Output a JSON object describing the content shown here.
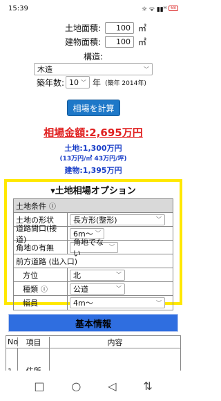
{
  "status": {
    "time": "15:39",
    "icons": "☼ ᯤ ▮▮ᴴ",
    "battery": "68"
  },
  "form": {
    "land_area_label": "土地面積:",
    "land_area_value": "100",
    "area_unit": "㎡",
    "building_area_label": "建物面積:",
    "building_area_value": "100",
    "structure_label": "構造:",
    "structure_value": "木造",
    "age_label": "築年数:",
    "age_value": "10",
    "age_unit": "年",
    "age_note": "(築年 2014年)"
  },
  "calc_button": "相場を計算",
  "result": {
    "total": "相場金額:2,695万円",
    "land": "土地:1,300万円",
    "land_detail": "(13万円/㎡ 43万円/坪)",
    "building": "建物:1,395万円"
  },
  "options": {
    "title": "▾土地相場オプション",
    "section_land": "土地条件",
    "shape_label": "土地の形状",
    "shape_value": "長方形(整形)",
    "frontage_label": "道路間口(接道)",
    "frontage_value": "6m〜",
    "corner_label": "角地の有無",
    "corner_value": "角地でない",
    "road_section": "前方道路 (出入口)",
    "direction_label": "方位",
    "direction_value": "北",
    "type_label": "種類",
    "type_value": "公道",
    "width_label": "幅員",
    "width_value": "4m〜"
  },
  "info": {
    "button": "基本情報",
    "headers": [
      "No",
      "項目",
      "内容"
    ],
    "row1": [
      "1",
      "住所",
      ""
    ]
  },
  "nav": {
    "square": "□",
    "circle": "○",
    "back": "◁",
    "extra": "⇅"
  }
}
